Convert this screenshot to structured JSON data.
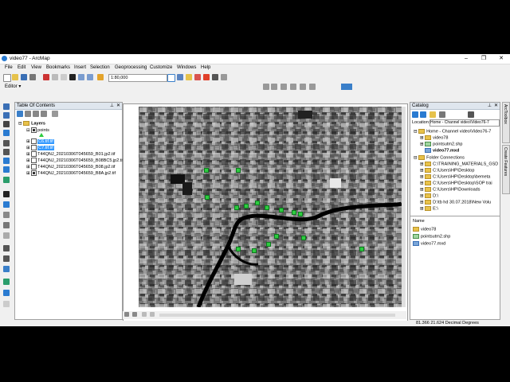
{
  "window": {
    "title": "video77 - ArcMap",
    "min": "–",
    "max": "❐",
    "close": "✕"
  },
  "menu": [
    "File",
    "Edit",
    "View",
    "Bookmarks",
    "Insert",
    "Selection",
    "Geoprocessing",
    "Customize",
    "Windows",
    "Help"
  ],
  "toolbar": {
    "scale": "1:80,000",
    "editor": "Editor ▾"
  },
  "toc": {
    "title": "Table Of Contents",
    "layers_label": "Layers",
    "points_label": "points",
    "items": [
      "C6.tif.tif",
      "C7.tif.tif",
      "T44QNJ_20210306T045659_B01.jp2.tif",
      "T44QNJ_20210306T045659_B08BC5.jp2.tif",
      "T44QNJ_20210306T045659_B08.jp2.tif",
      "T44QNJ_20210306T045659_B8A.jp2.tif"
    ]
  },
  "catalog": {
    "title": "Catalog",
    "location_label": "Location:",
    "location_value": "Home - Channel video\\Video76-7",
    "tree": [
      "Home - Channel video\\Video76-7",
      "video78",
      "pointsutm2.shp",
      "video77.mxd",
      "Folder Connections",
      "C:\\TRAINING_MATERIALS_GSD",
      "C:\\Users\\HP\\Desktop",
      "C:\\Users\\HP\\Desktop\\bemeta",
      "C:\\Users\\HP\\Desktop\\SOP trai",
      "C:\\Users\\HP\\Downloads",
      "D:\\",
      "D:\\tb hd 30.07.2018\\New Volu",
      "E:\\"
    ],
    "list_header": "Name",
    "list": [
      "video78",
      "pointsutm2.shp",
      "video77.mxd"
    ]
  },
  "sidebar_tabs": [
    "ArcToolbox",
    "Create Features"
  ],
  "status": {
    "coords": "81.366  21.624 Decimal Degrees"
  }
}
